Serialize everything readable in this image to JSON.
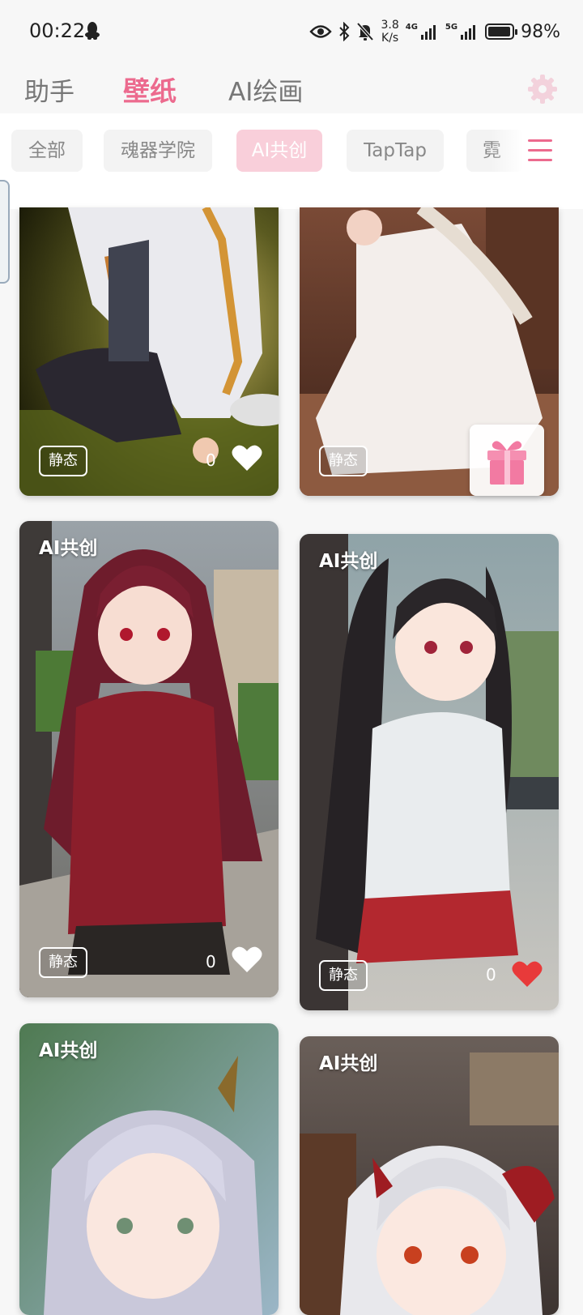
{
  "status_bar": {
    "time": "00:22",
    "speed_value": "3.8",
    "speed_unit": "K/s",
    "net_1": "4G",
    "net_2": "5G",
    "battery_percent": "98%",
    "battery_level": 0.98,
    "icons": [
      "qq-icon",
      "eye-icon",
      "bluetooth-icon",
      "mute-bell-icon",
      "signal-icon",
      "signal-icon",
      "battery-icon"
    ]
  },
  "header": {
    "tabs": [
      {
        "label": "助手"
      },
      {
        "label": "壁纸"
      },
      {
        "label": "AI绘画"
      }
    ],
    "active_tab": "壁纸",
    "settings_icon": "gear-icon"
  },
  "chips": [
    {
      "label": "全部"
    },
    {
      "label": "魂器学院"
    },
    {
      "label": "AI共创"
    },
    {
      "label": "TapTap"
    },
    {
      "label": "霓"
    }
  ],
  "active_chip": "AI共创",
  "menu_icon": "hamburger-menu-icon",
  "cards": [
    {
      "title": "",
      "badge": "静态",
      "likes": "0",
      "liked": false
    },
    {
      "title": "",
      "badge": "静态",
      "likes": "",
      "liked": false
    },
    {
      "title": "AI共创",
      "badge": "静态",
      "likes": "0",
      "liked": false
    },
    {
      "title": "AI共创",
      "badge": "静态",
      "likes": "0",
      "liked": true
    },
    {
      "title": "AI共创",
      "badge": "",
      "likes": "",
      "liked": false
    },
    {
      "title": "AI共创",
      "badge": "",
      "likes": "",
      "liked": false
    }
  ],
  "gift_icon": "gift-icon",
  "colors": {
    "accent": "#ec6a8e",
    "chip_active_bg": "#f9cfda",
    "liked_heart": "#e83a3a"
  }
}
